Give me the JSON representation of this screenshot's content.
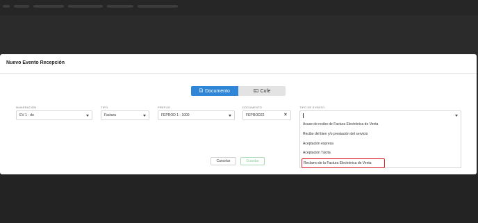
{
  "modal": {
    "title": "Nuevo Evento Recepción"
  },
  "toggle": {
    "documento_label": "Documento",
    "cufe_label": "Cufe"
  },
  "fields": {
    "numeracion": {
      "label": "NUMERACIÓN",
      "value": "EV 1 - do"
    },
    "tipo": {
      "label": "TIPO",
      "value": "Factura"
    },
    "prefijo": {
      "label": "PREFIJO",
      "value": "FEPROD 1 - 1000"
    },
    "documento": {
      "label": "DOCUMENTO",
      "value": "FEPROD22"
    },
    "tipo_evento": {
      "label": "TIPO DE EVENTO",
      "value": ""
    }
  },
  "dropdown": {
    "options": [
      "Acuse de recibo de Factura Electrónica de Venta",
      "Recibo del bien y/o prestación del servicio",
      "Aceptación expresa",
      "Aceptación Tácita",
      "Reclamo de la Factura Electrónica de Venta"
    ],
    "highlighted_index": 4
  },
  "buttons": {
    "cancel": "Cancelar",
    "save": "Guardar"
  },
  "icons": {
    "documento": "document-icon",
    "cufe": "card-icon",
    "clear": "close-icon",
    "caret": "chevron-down-icon"
  },
  "colors": {
    "primary": "#2f86d6",
    "highlight_border": "#d9202b",
    "save_text": "#8ccf9c"
  }
}
